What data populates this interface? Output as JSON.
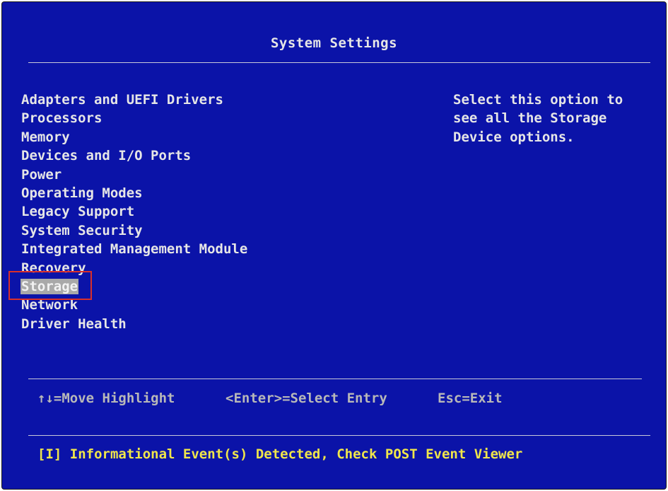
{
  "title": "System Settings",
  "menu": {
    "items": [
      {
        "label": "Adapters and UEFI Drivers"
      },
      {
        "label": "Processors"
      },
      {
        "label": "Memory"
      },
      {
        "label": "Devices and I/O Ports"
      },
      {
        "label": "Power"
      },
      {
        "label": "Operating Modes"
      },
      {
        "label": "Legacy Support"
      },
      {
        "label": "System Security"
      },
      {
        "label": "Integrated Management Module"
      },
      {
        "label": "Recovery"
      },
      {
        "label": "Storage"
      },
      {
        "label": "Network"
      },
      {
        "label": "Driver Health"
      }
    ],
    "selected": "Storage"
  },
  "help": {
    "lines": [
      "Select this option to",
      "see all the Storage",
      "Device options."
    ]
  },
  "footer": {
    "move": "↑↓=Move Highlight",
    "enter": "<Enter>=Select Entry",
    "exit": "Esc=Exit"
  },
  "status": {
    "message": "[I] Informational Event(s) Detected, Check POST Event Viewer"
  },
  "colors": {
    "background": "#0b13a8",
    "text": "#e6e6e6",
    "selection": "#a9a9a9",
    "status": "#f0e64a",
    "annotation": "#d9302a"
  }
}
